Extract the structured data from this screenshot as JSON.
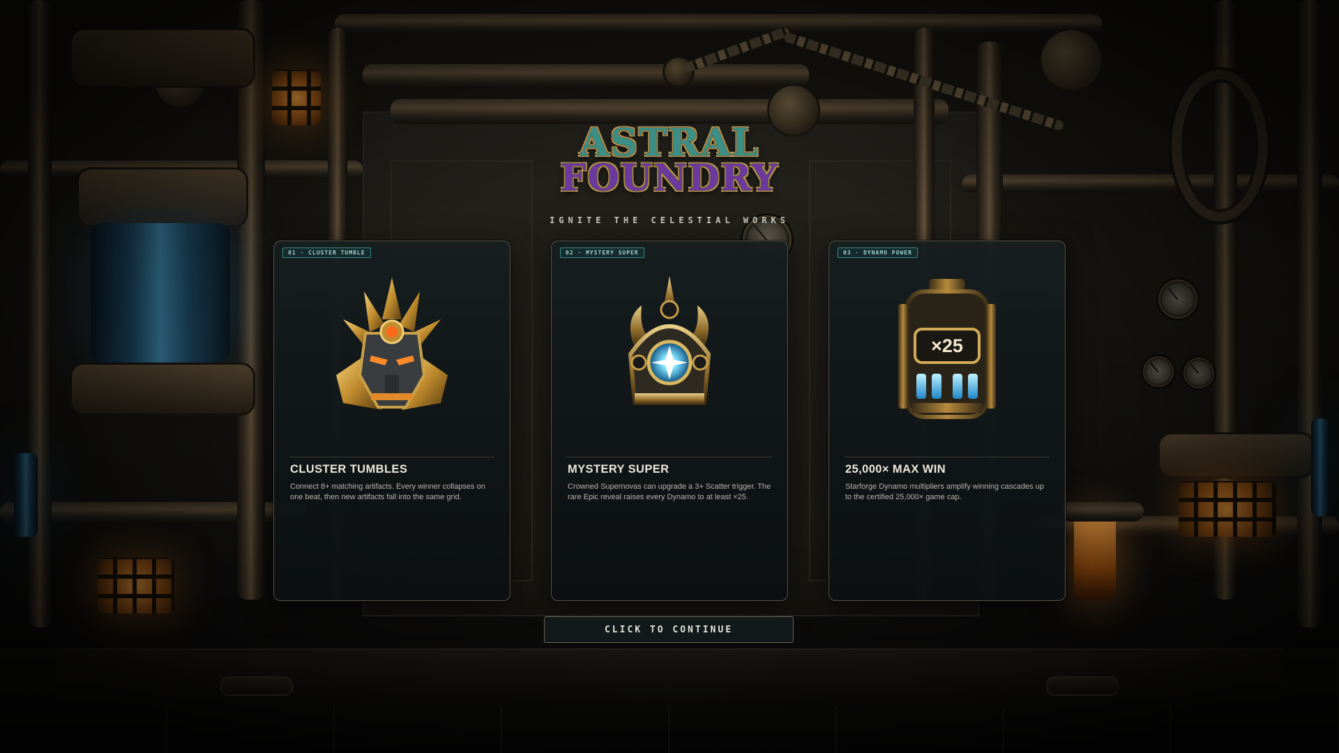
{
  "game": {
    "title_line1": "ASTRAL",
    "title_line2": "FOUNDRY",
    "tagline": "IGNITE THE CELESTIAL WORKS"
  },
  "cards": [
    {
      "badge": "01 · CLUSTER TUMBLE",
      "icon": "golden-mask-icon",
      "title": "CLUSTER TUMBLES",
      "description": "Connect 8+ matching artifacts. Every winner collapses on one beat, then new artifacts fall into the same grid."
    },
    {
      "badge": "02 · MYSTERY SUPER",
      "icon": "celestial-crown-icon",
      "title": "MYSTERY SUPER",
      "description": "Crowned Supernovas can upgrade a 3+ Scatter trigger. The rare Epic reveal raises every Dynamo to at least ×25."
    },
    {
      "badge": "03 · DYNAMO POWER",
      "icon": "dynamo-multiplier-icon",
      "multiplier_label": "×25",
      "title": "25,000× MAX WIN",
      "description": "Starforge Dynamo multipliers amplify winning cascades up to the certified 25,000× game cap."
    }
  ],
  "continue_label": "CLICK TO CONTINUE",
  "colors": {
    "accent_teal": "#3a8a84",
    "gold": "#c7a25a",
    "card_border": "#5b5648",
    "glow_blue": "#3e86aa",
    "molten_orange": "#f2a34a"
  }
}
